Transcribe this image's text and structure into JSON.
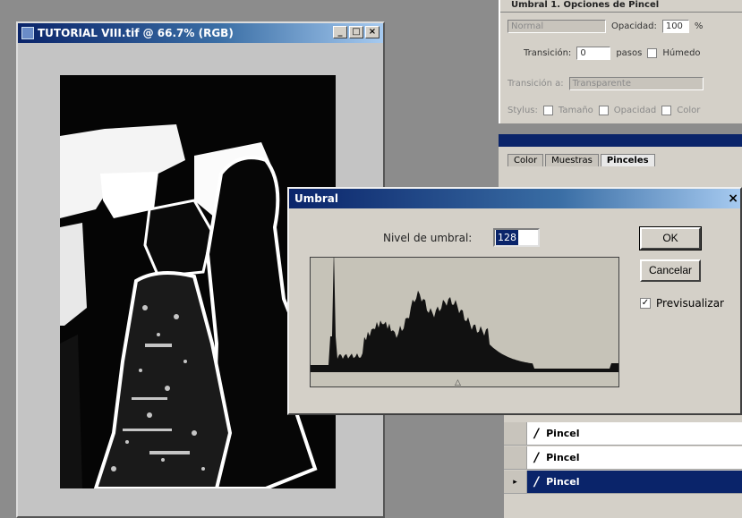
{
  "document": {
    "title": "TUTORIAL VIII.tif @ 66.7% (RGB)",
    "window_buttons": [
      "_",
      "□",
      "×"
    ]
  },
  "options": {
    "tabs": "Umbral 1. Opciones de Pincel",
    "mode": "Normal",
    "opacity_label": "Opacidad:",
    "opacity_value": "100",
    "opacity_unit": "%",
    "transition_label": "Transición:",
    "transition_value": "0",
    "steps_label": "pasos",
    "wet_label": "Húmedo",
    "transition_to_label": "Transición a:",
    "transition_to_value": "Transparente",
    "stylus_label": "Stylus:",
    "stylus_size": "Tamaño",
    "stylus_opacity": "Opacidad",
    "stylus_color": "Color"
  },
  "brush_panel": {
    "tabs": [
      "Color",
      "Muestras",
      "Pinceles"
    ]
  },
  "history": {
    "items": [
      "Pincel",
      "Pincel",
      "Pincel"
    ],
    "selected_index": 2
  },
  "dialog": {
    "title": "Umbral",
    "close": "×",
    "threshold_label": "Nivel de umbral:",
    "threshold_value": "128",
    "ok_label": "OK",
    "cancel_label": "Cancelar",
    "preview_label": "Previsualizar",
    "preview_checked": true,
    "marker": "△"
  }
}
